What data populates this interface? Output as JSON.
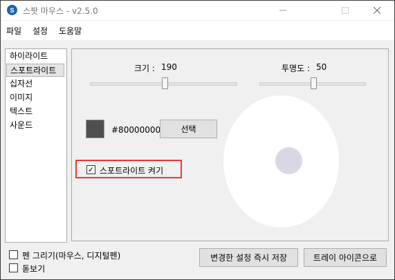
{
  "window": {
    "title": "스팟 마우스 - v2.5.0",
    "app_icon_glyph": "S"
  },
  "menu": [
    "파일",
    "설정",
    "도움말"
  ],
  "categories": {
    "selected_index": 1,
    "items": [
      "하이라이트",
      "스포트라이트",
      "십자선",
      "이미지",
      "텍스트",
      "사운드"
    ]
  },
  "spotlight": {
    "size_label": "크기 :",
    "size_value": "190",
    "opacity_label": "투명도 :",
    "opacity_value": "50",
    "size_slider_fraction": 0.51,
    "opacity_slider_fraction": 0.51,
    "color_hex": "#80000000",
    "swatch_color": "#4e4e4e",
    "choose_button": "선택",
    "enable_label": "스포트라이트 켜기",
    "enable_checked": true,
    "check_mark": "✓",
    "highlight_color": "#e53935"
  },
  "bottom": {
    "pen_draw_label": "펜 그리기(마우스, 디지털펜)",
    "pen_draw_checked": false,
    "magnifier_label": "돋보기",
    "magnifier_checked": false,
    "save_button": "변경한 설정 즉시 저장",
    "tray_button": "트레이 아이콘으로"
  }
}
